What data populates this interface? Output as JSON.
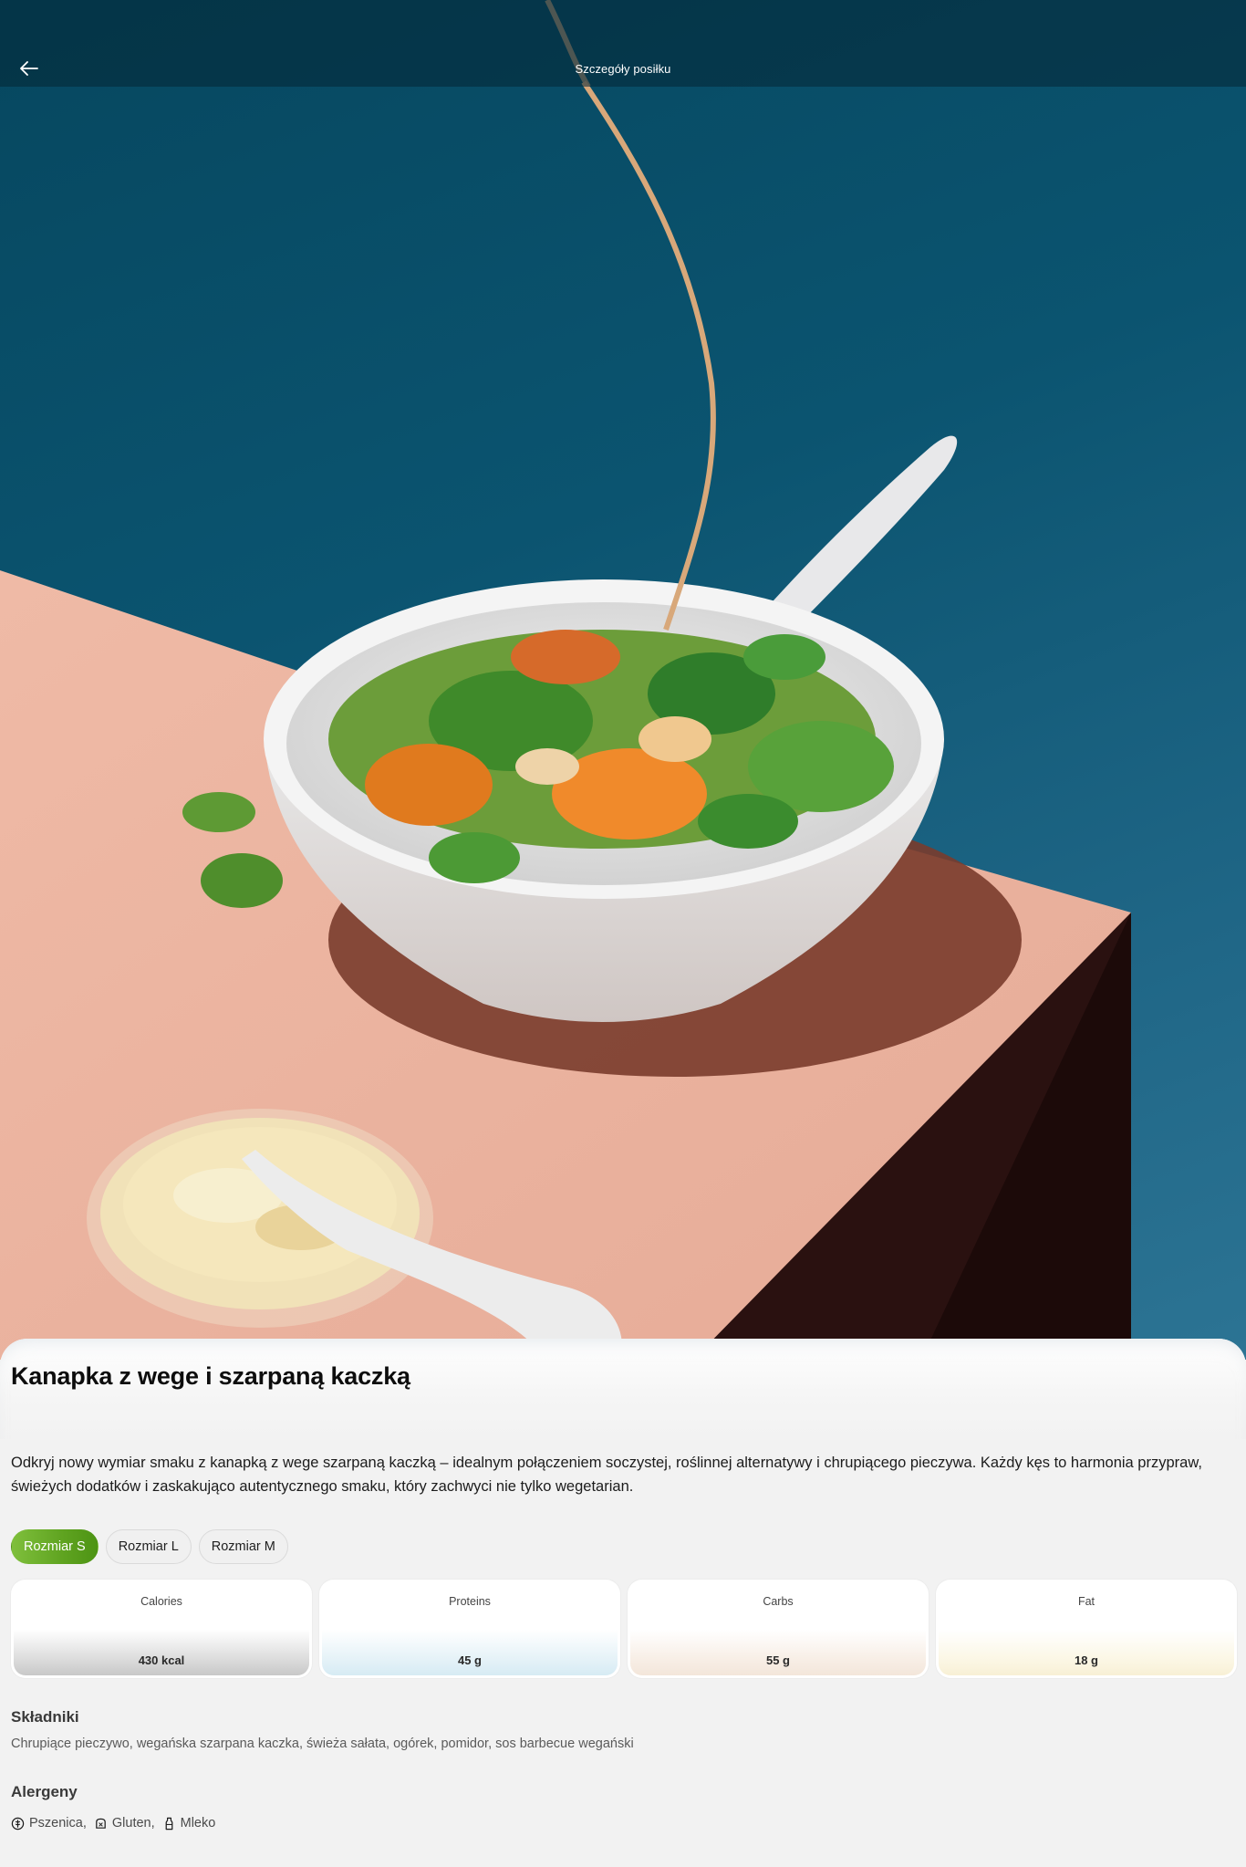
{
  "header": {
    "title": "Szczegóły posiłku",
    "back_icon": "arrow-left-icon"
  },
  "hero": {
    "image_description_icon": "meal-photo"
  },
  "meal": {
    "name": "Kanapka z wege i szarpaną kaczką",
    "description": "Odkryj nowy wymiar smaku z kanapką z wege szarpaną kaczką – idealnym połączeniem soczystej, roślinnej alternatywy i chrupiącego pieczywa. Każdy kęs to harmonia przypraw, świeżych dodatków i zaskakująco autentycznego smaku, który zachwyci nie tylko wegetarian."
  },
  "sizes": {
    "options": [
      "Rozmiar S",
      "Rozmiar L",
      "Rozmiar M"
    ],
    "selected": "Rozmiar S"
  },
  "nutrition": [
    {
      "label": "Calories",
      "value": "430 kcal",
      "tint": "#d9d9d9"
    },
    {
      "label": "Proteins",
      "value": "45 g",
      "tint": "#e3f1f7"
    },
    {
      "label": "Carbs",
      "value": "55 g",
      "tint": "#f7ede4"
    },
    {
      "label": "Fat",
      "value": "18 g",
      "tint": "#fbf6e3"
    }
  ],
  "ingredients": {
    "title": "Składniki",
    "text": "Chrupiące pieczywo, wegańska szarpana kaczka, świeża sałata, ogórek, pomidor, sos barbecue wegański"
  },
  "allergens": {
    "title": "Alergeny",
    "items": [
      {
        "label": "Pszenica,",
        "icon": "wheat-icon"
      },
      {
        "label": "Gluten,",
        "icon": "bread-icon"
      },
      {
        "label": "Mleko",
        "icon": "milk-bottle-icon"
      }
    ]
  },
  "colors": {
    "accent": "#5fa320",
    "hero_background": "#0b5470",
    "table_surface": "#e9b4a2"
  }
}
